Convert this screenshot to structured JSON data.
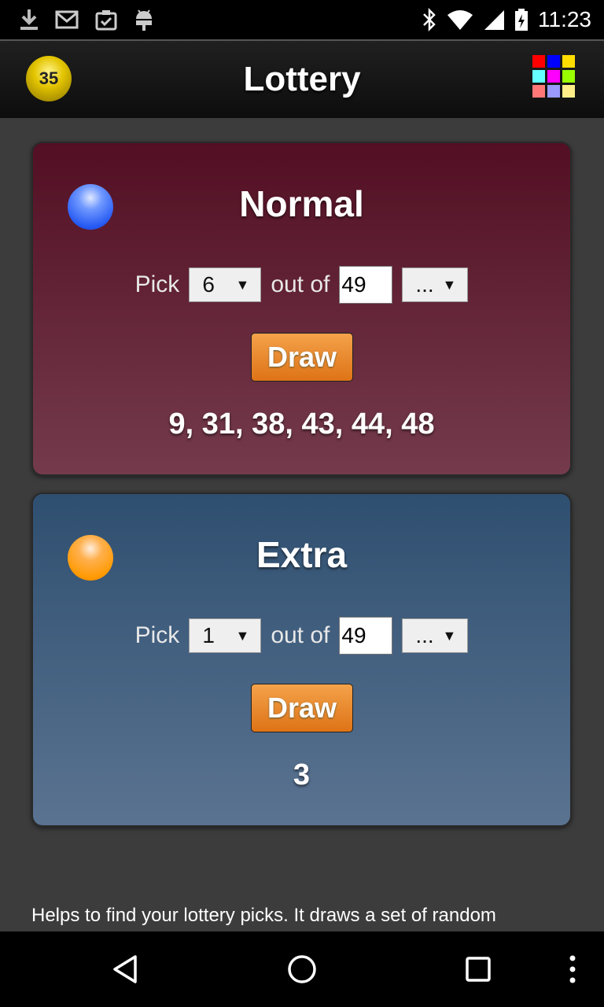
{
  "status_bar": {
    "time": "11:23",
    "icons_left": [
      "download-icon",
      "gmail-icon",
      "clipboard-check-icon",
      "android-icon"
    ],
    "icons_right": [
      "bluetooth-icon",
      "wifi-icon",
      "signal-icon",
      "battery-icon"
    ]
  },
  "app_bar": {
    "logo_number": "35",
    "title": "Lottery",
    "grid_colors": [
      "#ff0000",
      "#0000ff",
      "#ffdd00",
      "#66ffff",
      "#ff00ff",
      "#99ff00",
      "#ff7777",
      "#9999ff",
      "#ffee88"
    ]
  },
  "cards": [
    {
      "title": "Normal",
      "pick_label": "Pick",
      "pick_value": "6",
      "out_of_label": "out of",
      "out_of_value": "49",
      "extra_select": "...",
      "draw_label": "Draw",
      "result": "9, 31, 38, 43, 44, 48"
    },
    {
      "title": "Extra",
      "pick_label": "Pick",
      "pick_value": "1",
      "out_of_label": "out of",
      "out_of_value": "49",
      "extra_select": "...",
      "draw_label": "Draw",
      "result": "3"
    }
  ],
  "description": "Helps to find your lottery picks. It draws a set of random",
  "nav": [
    "back-icon",
    "home-icon",
    "recents-icon",
    "more-icon"
  ]
}
